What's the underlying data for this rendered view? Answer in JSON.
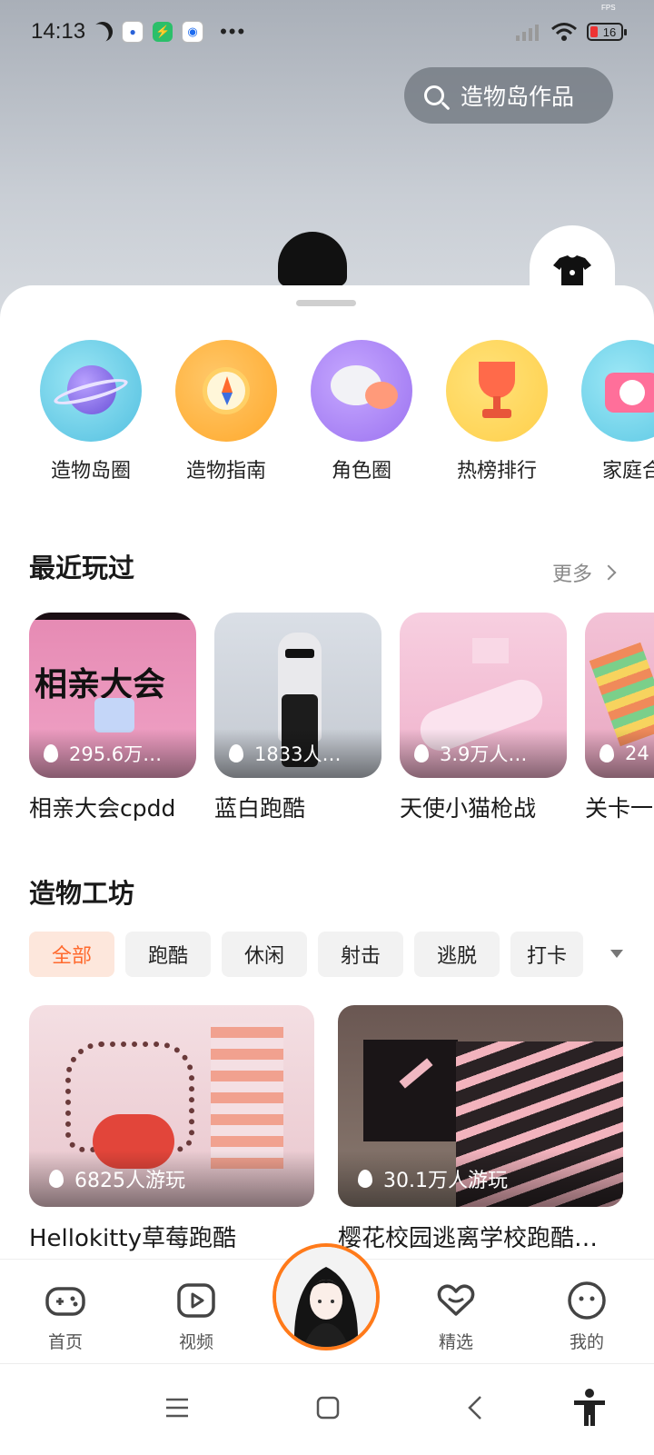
{
  "status": {
    "time": "14:13",
    "battery": "16",
    "fps_label": "FPS"
  },
  "search": {
    "label": "造物岛作品"
  },
  "categories": [
    {
      "label": "造物岛圈",
      "icon": "planet-icon"
    },
    {
      "label": "造物指南",
      "icon": "compass-icon"
    },
    {
      "label": "角色圈",
      "icon": "chat-bubbles-icon"
    },
    {
      "label": "热榜排行",
      "icon": "trophy-icon"
    },
    {
      "label": "家庭合",
      "icon": "camera-icon"
    }
  ],
  "recent": {
    "title": "最近玩过",
    "more": "更多",
    "items": [
      {
        "title": "相亲大会cpdd",
        "plays": "295.6万…",
        "thumb_text": "相亲大会"
      },
      {
        "title": "蓝白跑酷",
        "plays": "1833人…"
      },
      {
        "title": "天使小猫枪战",
        "plays": "3.9万人…"
      },
      {
        "title": "关卡一",
        "plays": "24"
      }
    ]
  },
  "workshop": {
    "title": "造物工坊",
    "chips": [
      "全部",
      "跑酷",
      "休闲",
      "射击",
      "逃脱",
      "打卡"
    ],
    "active_chip": "全部",
    "cards": [
      {
        "title": "Hellokitty草莓跑酷",
        "plays": "6825人游玩"
      },
      {
        "title": "樱花校园逃离学校跑酷…",
        "plays": "30.1万人游玩"
      }
    ]
  },
  "tabs": [
    {
      "label": "首页",
      "icon": "gamepad-icon"
    },
    {
      "label": "视频",
      "icon": "video-play-icon"
    },
    {
      "label": "精选",
      "icon": "heart-chat-icon"
    },
    {
      "label": "我的",
      "icon": "smiley-icon"
    }
  ],
  "colors": {
    "accent": "#ff6a2e",
    "active_chip_bg": "#fde7dc",
    "avatar_ring": "#ff7a1a"
  }
}
